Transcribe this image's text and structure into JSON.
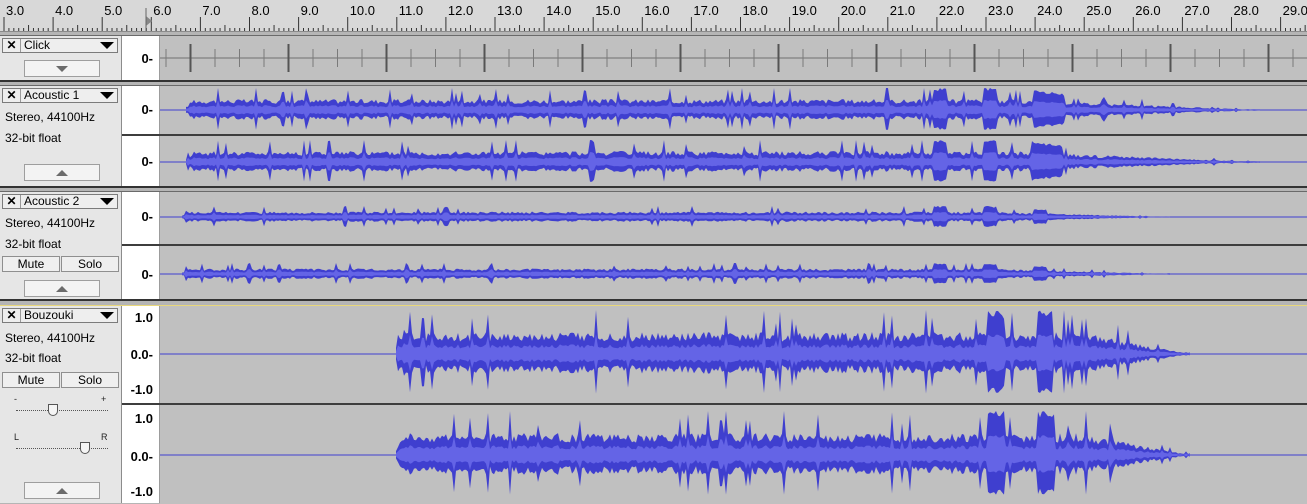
{
  "ruler": {
    "ticks": [
      "3.0",
      "4.0",
      "5.0",
      "6.0",
      "7.0",
      "8.0",
      "9.0",
      "10.0",
      "11.0",
      "12.0",
      "13.0",
      "14.0",
      "15.0",
      "16.0",
      "17.0",
      "18.0",
      "19.0",
      "20.0",
      "21.0",
      "22.0",
      "23.0",
      "24.0",
      "25.0",
      "26.0",
      "27.0",
      "28.0",
      "29.0"
    ]
  },
  "tracks": {
    "click": {
      "name": "Click",
      "vlabel": "0-"
    },
    "acoustic1": {
      "name": "Acoustic 1",
      "format": "Stereo, 44100Hz",
      "depth": "32-bit float",
      "vlabel_top": "0-",
      "vlabel_bottom": "0-"
    },
    "acoustic2": {
      "name": "Acoustic 2",
      "format": "Stereo, 44100Hz",
      "depth": "32-bit float",
      "mute": "Mute",
      "solo": "Solo",
      "vlabel_top": "0-",
      "vlabel_bottom": "0-"
    },
    "bouzouki": {
      "name": "Bouzouki",
      "format": "Stereo, 44100Hz",
      "depth": "32-bit float",
      "mute": "Mute",
      "solo": "Solo",
      "gain_minus": "-",
      "gain_plus": "+",
      "pan_left": "L",
      "pan_right": "R",
      "scale_top": [
        "1.0",
        "0.0-",
        "-1.0"
      ],
      "scale_bottom": [
        "1.0",
        "0.0-",
        "-1.0"
      ]
    }
  },
  "colors": {
    "waveform": "#3f3fcf",
    "waveform_rms": "#6464e6",
    "wave_bg": "#c0c0c0",
    "selection_border": "#e8d77a"
  }
}
